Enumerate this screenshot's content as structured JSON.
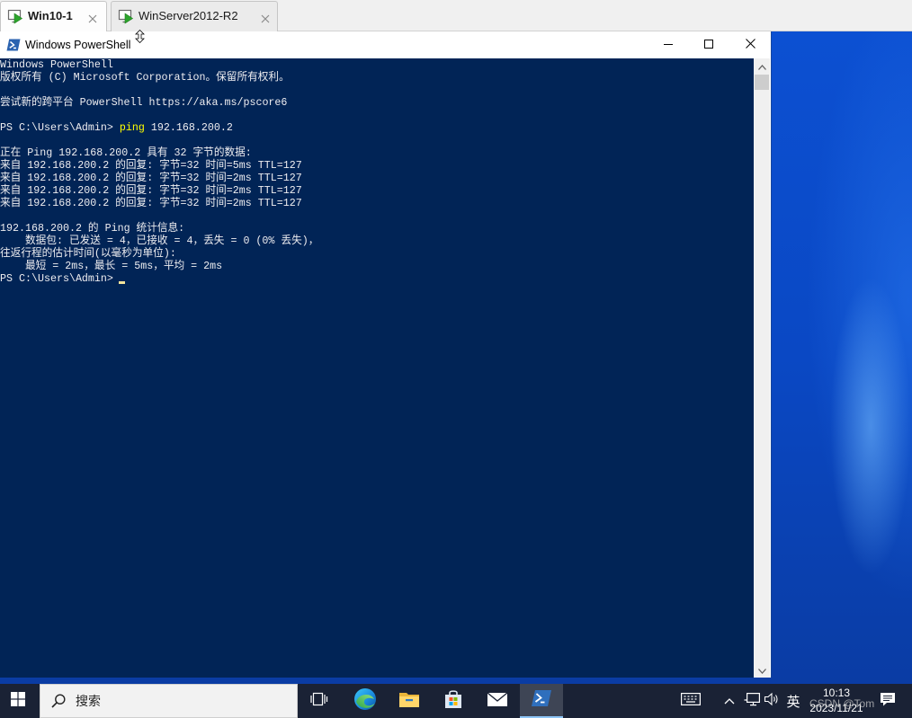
{
  "vm_tabs": [
    {
      "label": "Win10-1",
      "icon": "vm-running-icon",
      "close_icon": "close-icon",
      "active": true
    },
    {
      "label": "WinServer2012-R2",
      "icon": "vm-running-icon",
      "close_icon": "close-icon",
      "active": false
    }
  ],
  "window": {
    "title": "Windows PowerShell",
    "icon": "powershell-icon",
    "controls": [
      "minimize-icon",
      "maximize-icon",
      "close-icon"
    ]
  },
  "console": {
    "banner": [
      "Windows PowerShell",
      "版权所有 (C) Microsoft Corporation。保留所有权利。"
    ],
    "hint": "尝试新的跨平台 PowerShell https://aka.ms/pscore6",
    "prompt": "PS C:\\Users\\Admin>",
    "command": "ping",
    "command_args": "192.168.200.2",
    "output": {
      "start": "正在 Ping 192.168.200.2 具有 32 字节的数据:",
      "replies": [
        "来自 192.168.200.2 的回复: 字节=32 时间=5ms TTL=127",
        "来自 192.168.200.2 的回复: 字节=32 时间=2ms TTL=127",
        "来自 192.168.200.2 的回复: 字节=32 时间=2ms TTL=127",
        "来自 192.168.200.2 的回复: 字节=32 时间=2ms TTL=127"
      ],
      "stats_title": "192.168.200.2 的 Ping 统计信息:",
      "packets": "    数据包: 已发送 = 4，已接收 = 4，丢失 = 0 (0% 丢失)，",
      "rtt_title": "往返行程的估计时间(以毫秒为单位):",
      "rtt": "    最短 = 2ms，最长 = 5ms，平均 = 2ms"
    }
  },
  "taskbar": {
    "start_icon": "windows-logo-icon",
    "search": {
      "icon": "search-icon",
      "placeholder": "搜索"
    },
    "pinned": [
      {
        "icon": "task-view-icon",
        "active": false
      },
      {
        "icon": "edge-icon",
        "active": false
      },
      {
        "icon": "folder-icon",
        "active": false
      },
      {
        "icon": "store-icon",
        "active": false
      },
      {
        "icon": "mail-icon",
        "active": false
      },
      {
        "icon": "powershell-icon",
        "active": true
      }
    ],
    "tray": {
      "icons": [
        "touch-keyboard-icon",
        "chevron-up-icon",
        "network-icon",
        "volume-icon"
      ],
      "ime": "英",
      "time": "10:13",
      "date": "2023/11/21",
      "notification_icon": "notification-icon"
    }
  },
  "watermark": "CSDN @Tom",
  "colors": {
    "console_background": "#012456",
    "console_text": "#eeedf0",
    "command_token": "#ffff00",
    "cursor": "#f2e39c",
    "taskbar": "#1a2235",
    "active_app_indicator": "#8cc4f5"
  }
}
